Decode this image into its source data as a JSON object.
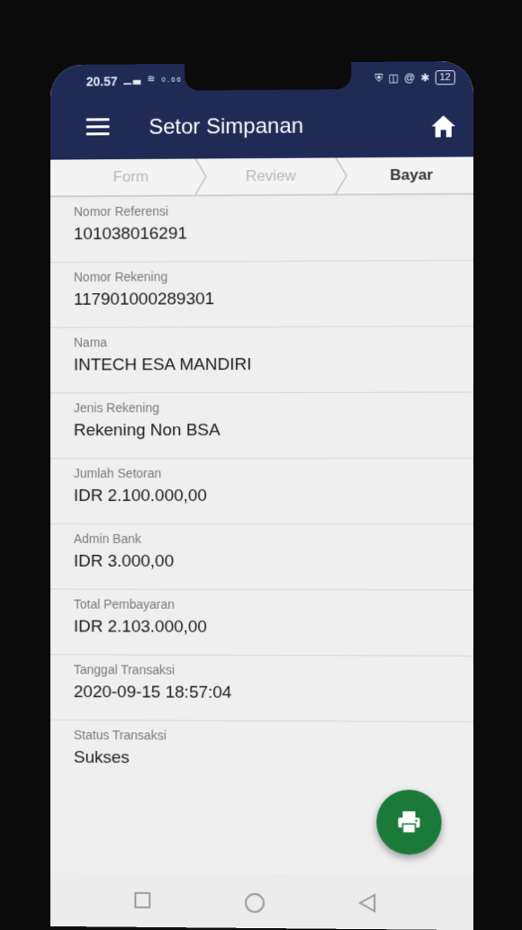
{
  "status_bar": {
    "time": "20.57",
    "net_speed": "0,66 KB/S",
    "battery": "12"
  },
  "app_bar": {
    "title": "Setor Simpanan",
    "menu_icon": "hamburger-menu-icon",
    "home_icon": "home-icon"
  },
  "stepper": {
    "steps": [
      {
        "label": "Form",
        "active": false
      },
      {
        "label": "Review",
        "active": false
      },
      {
        "label": "Bayar",
        "active": true
      }
    ]
  },
  "fields": [
    {
      "label": "Nomor Referensi",
      "value": "101038016291"
    },
    {
      "label": "Nomor Rekening",
      "value": "117901000289301"
    },
    {
      "label": "Nama",
      "value": "INTECH ESA MANDIRI"
    },
    {
      "label": "Jenis Rekening",
      "value": "Rekening Non BSA"
    },
    {
      "label": "Jumlah Setoran",
      "value": "IDR 2.100.000,00"
    },
    {
      "label": "Admin Bank",
      "value": "IDR 3.000,00"
    },
    {
      "label": "Total Pembayaran",
      "value": "IDR 2.103.000,00"
    },
    {
      "label": "Tanggal Transaksi",
      "value": "2020-09-15 18:57:04"
    },
    {
      "label": "Status Transaksi",
      "value": "Sukses"
    }
  ],
  "fab": {
    "icon": "print-icon",
    "color": "#1b7a3a"
  },
  "colors": {
    "appbar": "#1f2a55",
    "background": "#efefef"
  }
}
